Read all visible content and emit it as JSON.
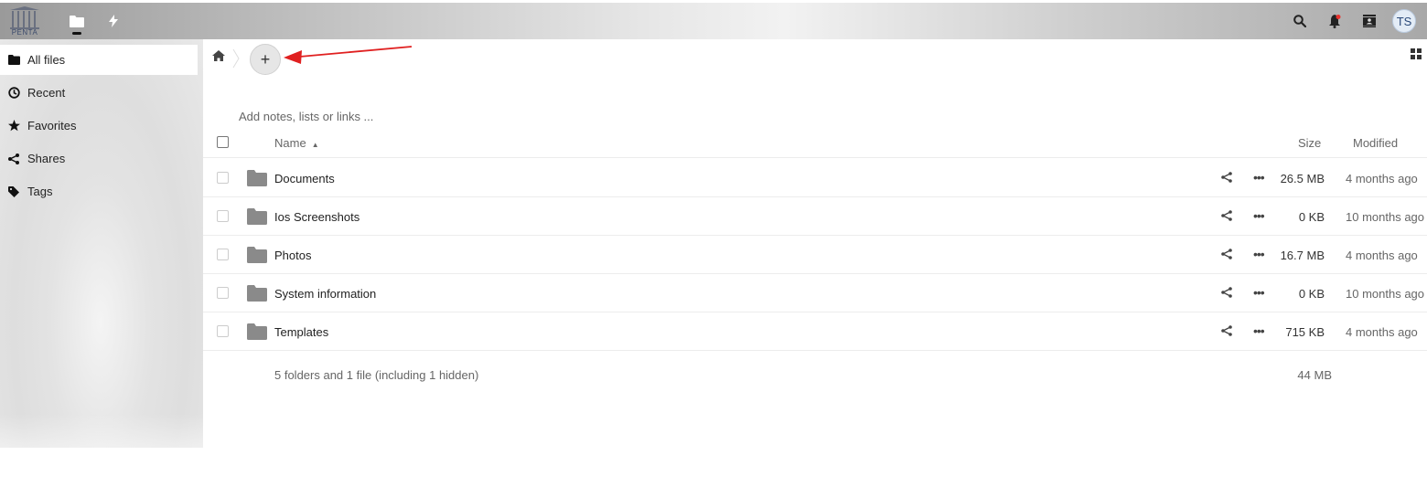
{
  "header": {
    "logo_text": "PENTA",
    "apps": [
      {
        "name": "Files",
        "icon": "folder-icon",
        "active": true
      },
      {
        "name": "Activity",
        "icon": "lightning-icon",
        "active": false
      }
    ],
    "right": [
      {
        "icon": "search-icon"
      },
      {
        "icon": "notifications-icon"
      },
      {
        "icon": "contacts-icon"
      }
    ],
    "avatar_initials": "TS"
  },
  "sidebar": {
    "items": [
      {
        "label": "All files",
        "icon": "folder-icon",
        "active": true
      },
      {
        "label": "Recent",
        "icon": "clock-icon"
      },
      {
        "label": "Favorites",
        "icon": "star-icon"
      },
      {
        "label": "Shares",
        "icon": "share-icon"
      },
      {
        "label": "Tags",
        "icon": "tag-icon"
      }
    ]
  },
  "toolbar": {
    "add_label": "+"
  },
  "notes": {
    "placeholder": "Add notes, lists or links ..."
  },
  "table": {
    "columns": {
      "name": "Name",
      "size": "Size",
      "modified": "Modified"
    },
    "rows": [
      {
        "name": "Documents",
        "size": "26.5 MB",
        "modified": "4 months ago"
      },
      {
        "name": "Ios Screenshots",
        "size": "0 KB",
        "modified": "10 months ago"
      },
      {
        "name": "Photos",
        "size": "16.7 MB",
        "modified": "4 months ago"
      },
      {
        "name": "System information",
        "size": "0 KB",
        "modified": "10 months ago"
      },
      {
        "name": "Templates",
        "size": "715 KB",
        "modified": "4 months ago"
      }
    ],
    "summary": "5 folders and 1 file (including 1 hidden)",
    "summary_size": "44 MB"
  },
  "colors": {
    "annotation_arrow": "#e02020",
    "folder": "#8a8a8a"
  }
}
